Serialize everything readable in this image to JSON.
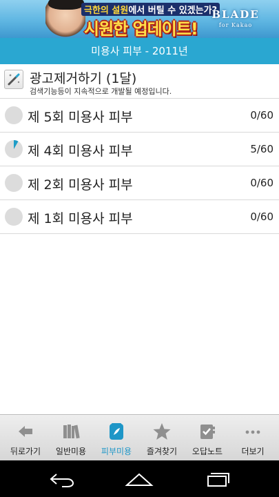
{
  "ad": {
    "headline_highlight": "극한의 설원",
    "headline_rest": "에서 버틸 수 있겠는가?",
    "slogan": "시원한 업데이트!",
    "brand": "BLADE",
    "brand_sub": "for Kakao"
  },
  "title": "미용사 피부 - 2011년",
  "promo": {
    "title": "광고제거하기 (1달)",
    "description": "검색기능등이 지속적으로 개발될 예정입니다.",
    "icon": "wand-icon"
  },
  "exams": [
    {
      "label": "제 5회 미용사 피부",
      "score": "0/60",
      "progress": 0.0
    },
    {
      "label": "제 4회 미용사 피부",
      "score": "5/60",
      "progress": 0.0833
    },
    {
      "label": "제 2회 미용사 피부",
      "score": "0/60",
      "progress": 0.0
    },
    {
      "label": "제 1회 미용사 피부",
      "score": "0/60",
      "progress": 0.0
    }
  ],
  "tabs": [
    {
      "label": "뒤로가기",
      "icon": "back-arrow-icon",
      "active": false
    },
    {
      "label": "일반미용",
      "icon": "books-icon",
      "active": false
    },
    {
      "label": "피부미용",
      "icon": "notebook-icon",
      "active": true
    },
    {
      "label": "즐겨찾기",
      "icon": "star-icon",
      "active": false
    },
    {
      "label": "오답노트",
      "icon": "note-check-icon",
      "active": false
    },
    {
      "label": "더보기",
      "icon": "more-dots-icon",
      "active": false
    }
  ],
  "colors": {
    "accent": "#2aa7d1",
    "tab_active": "#1e96c7",
    "progress_fill": "#1e9dc7",
    "progress_track": "#dcdcdc"
  }
}
